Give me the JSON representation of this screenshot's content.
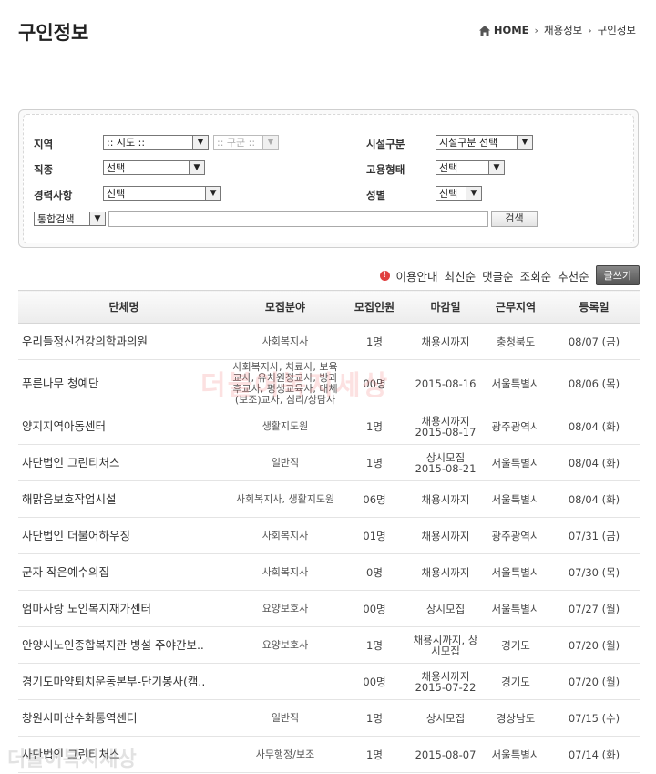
{
  "page": {
    "title": "구인정보"
  },
  "breadcrumb": {
    "home": "HOME",
    "level1": "채용정보",
    "level2": "구인정보"
  },
  "search": {
    "region_label": "지역",
    "region_select": ":: 시도 ::",
    "district_select": ":: 구군 ::",
    "facility_label": "시설구분",
    "facility_select": "시설구분 선택",
    "job_label": "직종",
    "job_select": "선택",
    "employment_label": "고용형태",
    "employment_select": "선택",
    "career_label": "경력사항",
    "career_select": "선택",
    "gender_label": "성별",
    "gender_select": "선택",
    "integrated_select": "통합검색",
    "keyword_value": "",
    "search_button": "검색"
  },
  "sort": {
    "guide": "이용안내",
    "latest": "최신순",
    "comments": "댓글순",
    "views": "조회순",
    "recommend": "추천순",
    "write_button": "글쓰기"
  },
  "table": {
    "headers": [
      "단체명",
      "모집분야",
      "모집인원",
      "마감일",
      "근무지역",
      "등록일"
    ],
    "rows": [
      {
        "org": "우리들정신건강의학과의원",
        "field": "사회복지사",
        "count": "1명",
        "deadline": "채용시까지",
        "region": "충청북도",
        "date": "08/07 (금)"
      },
      {
        "org": "푸른나무 청예단",
        "field": "사회복지사, 치료사, 보육교사, 유치원정교사, 방과후교사, 평생교육사, 대체(보조)교사, 심리/상담사",
        "count": "00명",
        "deadline": "2015-08-16",
        "region": "서울특별시",
        "date": "08/06 (목)"
      },
      {
        "org": "양지지역아동센터",
        "field": "생활지도원",
        "count": "1명",
        "deadline": "채용시까지 2015-08-17",
        "region": "광주광역시",
        "date": "08/04 (화)"
      },
      {
        "org": "사단법인 그린티처스",
        "field": "일반직",
        "count": "1명",
        "deadline": "상시모집 2015-08-21",
        "region": "서울특별시",
        "date": "08/04 (화)"
      },
      {
        "org": "해맑음보호작업시설",
        "field": "사회복지사, 생활지도원",
        "count": "06명",
        "deadline": "채용시까지",
        "region": "서울특별시",
        "date": "08/04 (화)"
      },
      {
        "org": "사단법인 더불어하우징",
        "field": "사회복지사",
        "count": "01명",
        "deadline": "채용시까지",
        "region": "광주광역시",
        "date": "07/31 (금)"
      },
      {
        "org": "군자 작은예수의집",
        "field": "사회복지사",
        "count": "0명",
        "deadline": "채용시까지",
        "region": "서울특별시",
        "date": "07/30 (목)"
      },
      {
        "org": "엄마사랑 노인복지재가센터",
        "field": "요양보호사",
        "count": "00명",
        "deadline": "상시모집",
        "region": "서울특별시",
        "date": "07/27 (월)"
      },
      {
        "org": "안양시노인종합복지관 병설 주야간보..",
        "field": "요양보호사",
        "count": "1명",
        "deadline": "채용시까지, 상시모집",
        "region": "경기도",
        "date": "07/20 (월)"
      },
      {
        "org": "경기도마약퇴치운동본부-단기봉사(캠..",
        "field": "",
        "count": "00명",
        "deadline": "채용시까지 2015-07-22",
        "region": "경기도",
        "date": "07/20 (월)"
      },
      {
        "org": "창원시마산수화통역센터",
        "field": "일반직",
        "count": "1명",
        "deadline": "상시모집",
        "region": "경상남도",
        "date": "07/15 (수)"
      },
      {
        "org": "사단법인 그린티처스",
        "field": "사무행정/보조",
        "count": "1명",
        "deadline": "2015-08-07",
        "region": "서울특별시",
        "date": "07/14 (화)"
      }
    ]
  },
  "watermark": {
    "text1": "더불어복지세상",
    "text2": "더불어복지세상"
  }
}
